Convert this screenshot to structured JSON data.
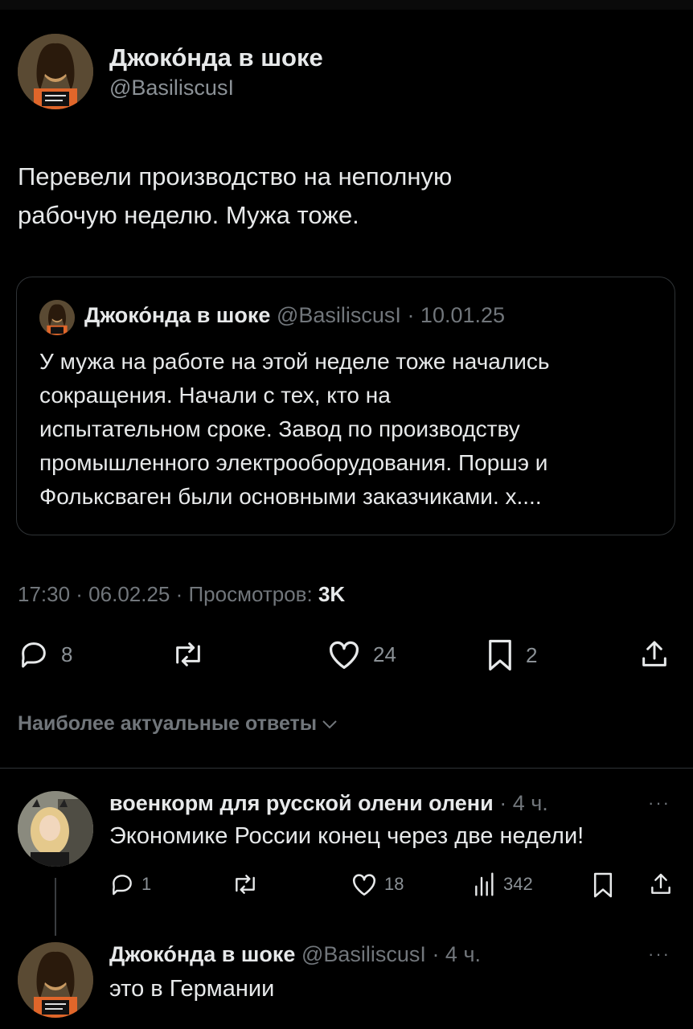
{
  "main_tweet": {
    "author_name": "Джоко́нда в шоке",
    "author_handle": "@BasiliscusI",
    "text_line1": "Перевели производство на неполную",
    "text_line2": "рабочую неделю. Мужа тоже.",
    "quote": {
      "author_name": "Джоко́нда в шоке",
      "author_handle": "@BasiliscusI",
      "date": "· 10.01.25",
      "lines": [
        "У мужа на работе на этой неделе тоже начались",
        "сокращения. Начали с тех, кто на",
        "испытательном сроке. Завод по производству",
        "промышленного электрооборудования. Поршэ и",
        "Фольксваген были основными заказчиками. х...."
      ]
    },
    "meta_time": "17:30 · 06.02.25 · Просмотров: ",
    "meta_views": "3K",
    "actions": {
      "replies": "8",
      "reposts": "",
      "likes": "24",
      "bookmarks": "2"
    }
  },
  "replies_header": "Наиболее актуальные ответы",
  "replies": [
    {
      "author_name": "военкорм для русской олени олени",
      "time": "· 4 ч.",
      "more": "···",
      "text": "Экономике России конец через две недели!",
      "actions": {
        "replies": "1",
        "likes": "18",
        "views": "342"
      }
    },
    {
      "author_name": "Джоко́нда в шоке",
      "author_handle": "@BasiliscusI",
      "time": "· 4 ч.",
      "more": "···",
      "text": "это в Германии"
    }
  ],
  "colors": {
    "background": "#000000",
    "text": "#e7e9ea",
    "muted": "#71767b",
    "border": "#2f3336"
  }
}
